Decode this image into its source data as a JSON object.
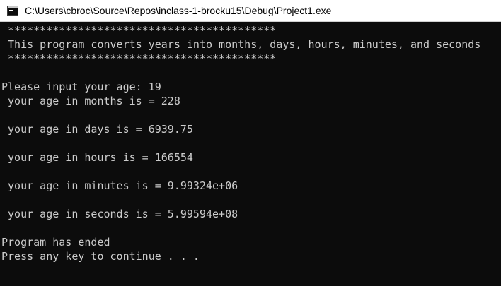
{
  "window": {
    "title": "C:\\Users\\cbroc\\Source\\Repos\\inclass-1-brocku15\\Debug\\Project1.exe"
  },
  "console": {
    "lines": [
      " ******************************************",
      " This program converts years into months, days, hours, minutes, and seconds",
      " ******************************************",
      "",
      "Please input your age: 19",
      " your age in months is = 228",
      "",
      " your age in days is = 6939.75",
      "",
      " your age in hours is = 166554",
      "",
      " your age in minutes is = 9.99324e+06",
      "",
      " your age in seconds is = 5.99594e+08",
      "",
      "Program has ended",
      "Press any key to continue . . ."
    ]
  }
}
